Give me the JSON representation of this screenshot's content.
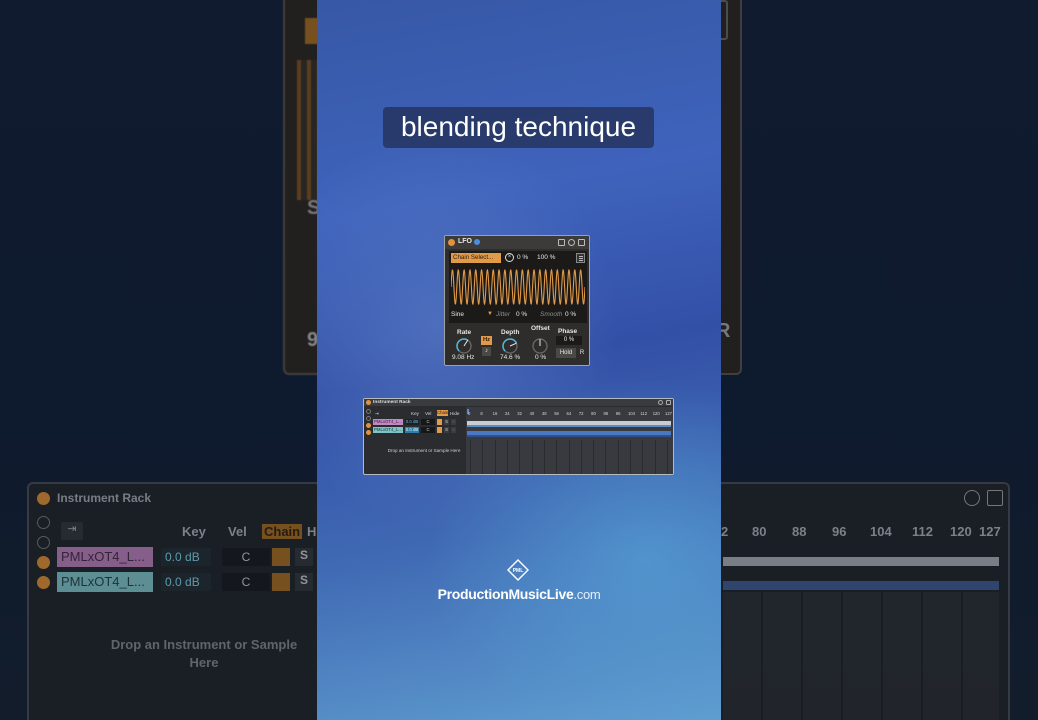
{
  "caption": "blending technique",
  "lfo": {
    "title": "LFO",
    "map_target": "Chain Select...",
    "min_amount": "0 %",
    "max_amount": "100 %",
    "shape": "Sine",
    "jitter_label": "Jitter",
    "jitter_value": "0 %",
    "smooth_label": "Smooth",
    "smooth_value": "0 %",
    "rate_label": "Rate",
    "rate_value": "9.08 Hz",
    "rate_mode": "Hz",
    "sync_icon": "♪",
    "depth_label": "Depth",
    "depth_value": "74.6 %",
    "offset_label": "Offset",
    "offset_value": "0 %",
    "phase_label": "Phase",
    "phase_value": "0 %",
    "hold_label": "Hold",
    "retrigger_label": "R",
    "knobs": {
      "rate": 0.62,
      "depth": 0.746,
      "offset": 0.5
    },
    "colors": {
      "accent": "#e19a48",
      "wave": "#e19a48",
      "knob_ring": "#4fb8e0"
    }
  },
  "rack": {
    "title": "Instrument Rack",
    "columns": {
      "key": "Key",
      "vel": "Vel",
      "chain": "Chain",
      "hide": "Hide"
    },
    "chains": [
      {
        "name": "PMLxOT4_L...",
        "volume": "0.0 dB",
        "pan": "C",
        "solo": "S"
      },
      {
        "name": "PMLxOT4_L...",
        "volume": "0.0 dB",
        "pan": "C",
        "solo": "S"
      }
    ],
    "drop_text": "Drop an Instrument or Sample Here",
    "zone_ruler": [
      "0",
      "8",
      "16",
      "24",
      "32",
      "40",
      "48",
      "56",
      "64",
      "72",
      "80",
      "88",
      "96",
      "104",
      "112",
      "120",
      "127"
    ],
    "colors": {
      "chain1": "#c08ac3",
      "chain2": "#7ec3c6",
      "zone_bar": "#4a78c2"
    }
  },
  "background": {
    "rack_title": "Instrument Rack",
    "columns": [
      "Key",
      "Vel",
      "Chain",
      "Hi"
    ],
    "chain_names": [
      "PMLxOT4_L...",
      "PMLxOT4_L..."
    ],
    "volumes": [
      "0.0 dB",
      "0.0 dB"
    ],
    "pans": [
      "C",
      "C"
    ],
    "solos": [
      "S",
      "S"
    ],
    "drop_text": "Drop an Instrument or Sample Here",
    "ruler": [
      "2",
      "80",
      "88",
      "96",
      "104",
      "112",
      "120",
      "127"
    ],
    "lfo_left_labels": [
      "S",
      "9"
    ],
    "lfo_right_label": "R"
  },
  "logo": {
    "mark": "PML",
    "brand": "ProductionMusicLive",
    "domain": ".com"
  }
}
